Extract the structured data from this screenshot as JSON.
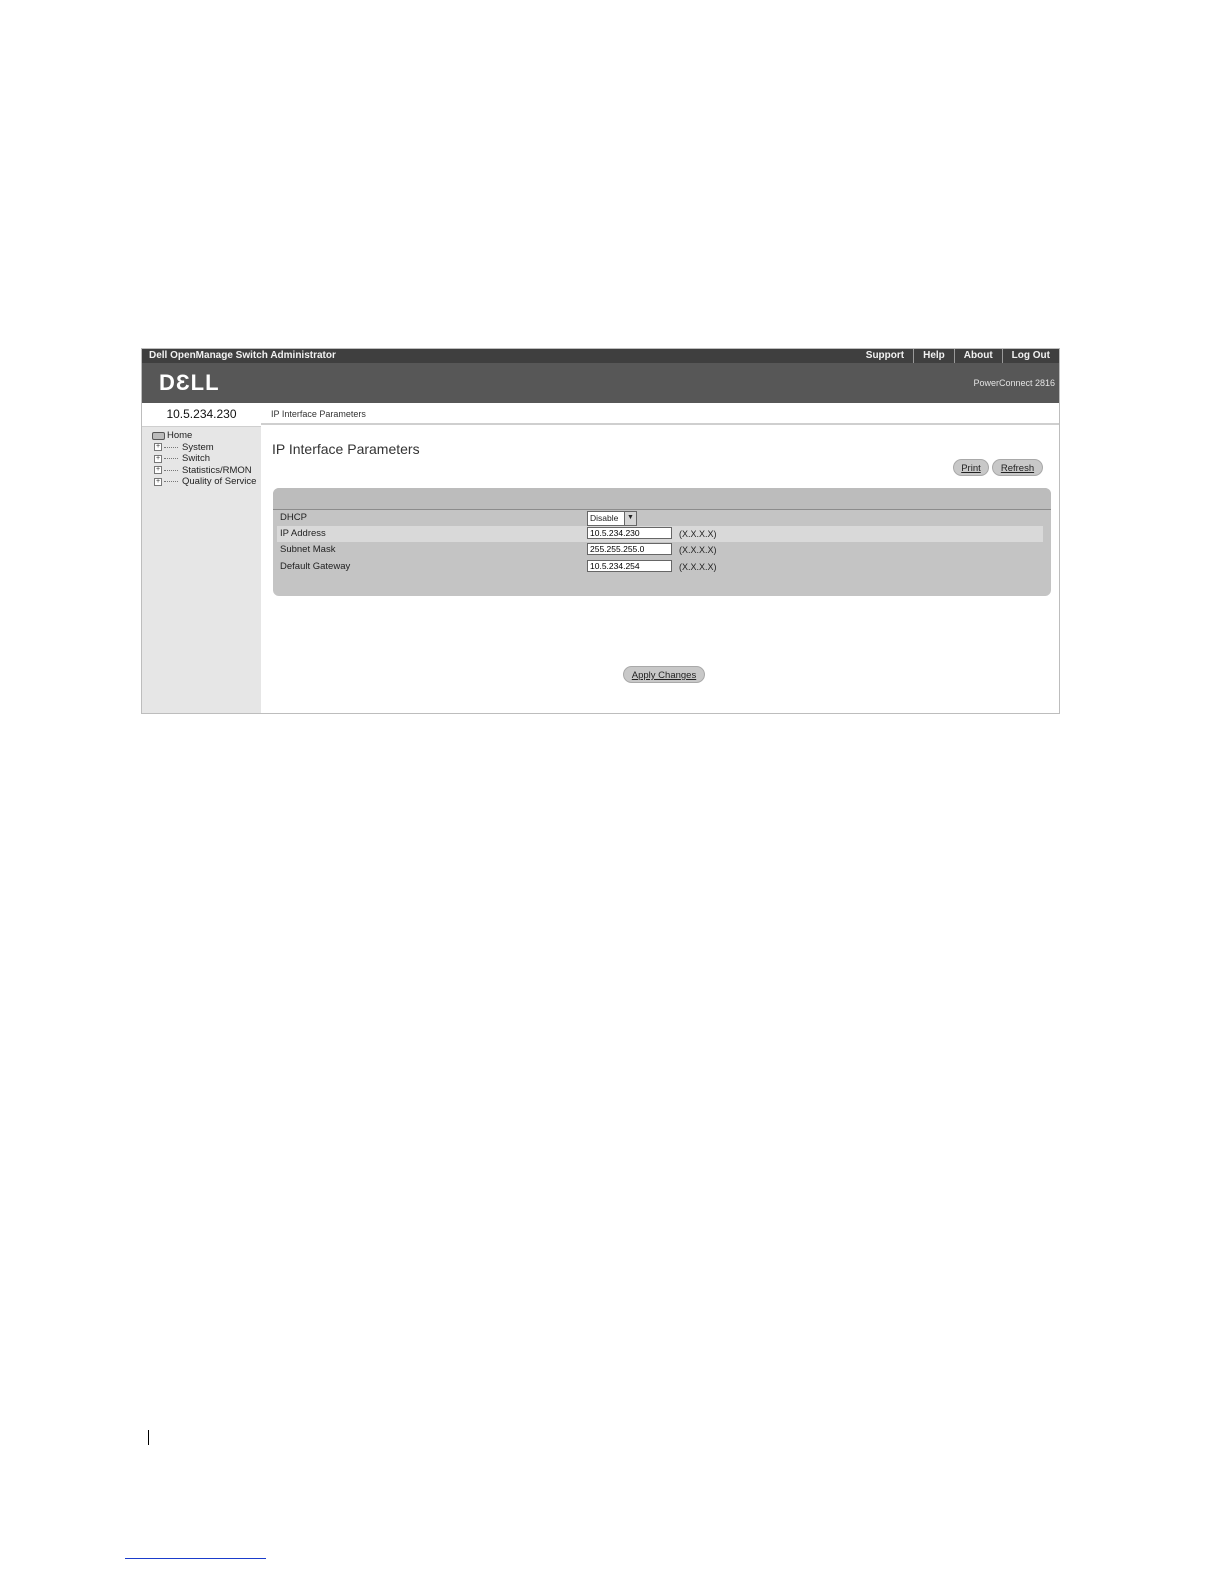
{
  "app": {
    "title": "Dell OpenManage Switch Administrator",
    "links": [
      "Support",
      "Help",
      "About",
      "Log Out"
    ],
    "logo": "DƐLL",
    "product": "PowerConnect 2816"
  },
  "sidebar": {
    "device_ip": "10.5.234.230",
    "home_label": "Home",
    "items": [
      {
        "label": "System"
      },
      {
        "label": "Switch"
      },
      {
        "label": "Statistics/RMON"
      },
      {
        "label": "Quality of Service"
      }
    ]
  },
  "main": {
    "breadcrumb": "IP Interface Parameters",
    "title": "IP Interface Parameters",
    "print_label": "Print",
    "refresh_label": "Refresh",
    "apply_label": "Apply Changes",
    "form": {
      "dhcp_label": "DHCP",
      "dhcp_value": "Disable",
      "ip_label": "IP Address",
      "ip_value": "10.5.234.230",
      "ip_format": "(X.X.X.X)",
      "mask_label": "Subnet Mask",
      "mask_value": "255.255.255.0",
      "mask_format": "(X.X.X.X)",
      "gateway_label": "Default Gateway",
      "gateway_value": "10.5.234.254",
      "gateway_format": "(X.X.X.X)"
    }
  }
}
